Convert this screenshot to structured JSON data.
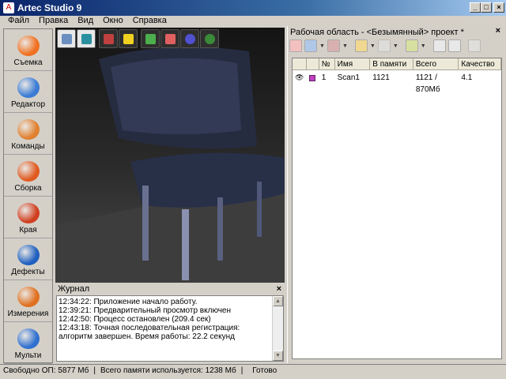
{
  "window": {
    "title": "Artec Studio 9",
    "minimize": "_",
    "maximize": "□",
    "close": "×"
  },
  "menu": [
    "Файл",
    "Правка",
    "Вид",
    "Окно",
    "Справка"
  ],
  "sidebar": [
    {
      "label": "Съемка",
      "color": "#f07020"
    },
    {
      "label": "Редактор",
      "color": "#3a7bd5"
    },
    {
      "label": "Команды",
      "color": "#e08030"
    },
    {
      "label": "Сборка",
      "color": "#e05a20"
    },
    {
      "label": "Края",
      "color": "#d04020"
    },
    {
      "label": "Дефекты",
      "color": "#2060c0"
    },
    {
      "label": "Измерения",
      "color": "#e07020"
    },
    {
      "label": "Мульти",
      "color": "#3070d0"
    }
  ],
  "viewport_tools": [
    {
      "name": "home-view",
      "color": "#6a8fc0",
      "active": true
    },
    {
      "name": "fit-view",
      "color": "#2a90a0",
      "active": true
    },
    {
      "name": "axes",
      "color": "#c04040"
    },
    {
      "name": "light",
      "color": "#f0d020"
    },
    {
      "name": "texture-cube",
      "color": "#4cae4c"
    },
    {
      "name": "solid-cube",
      "color": "#e06060"
    },
    {
      "name": "sphere",
      "color": "#5050d0"
    },
    {
      "name": "moon",
      "color": "#3a8a3a"
    }
  ],
  "journal": {
    "title": "Журнал",
    "close": "×",
    "lines": [
      "12:34:22: Приложение начало работу.",
      "12:39:21: Предварительный просмотр включен",
      "12:42:50: Процесс остановлен (209.4 сек)",
      "12:43:18: Точная последовательная регистрация: алгоритм завершен. Время работы: 22.2 секунд"
    ]
  },
  "workspace": {
    "title": "Рабочая область - <Безымянный> проект *",
    "close": "×",
    "columns": [
      "",
      "",
      "№",
      "Имя",
      "В памяти",
      "Всего",
      "Качество"
    ],
    "rows": [
      {
        "visible": "👁",
        "color": "#c040c0",
        "num": "1",
        "name": "Scan1",
        "in_memory": "1121",
        "total": "1121 / 870Мб",
        "quality": "4.1"
      }
    ]
  },
  "status": {
    "free": "Свободно ОП: 5877 Мб",
    "sep": "|",
    "used": "Всего памяти используется: 1238 Мб",
    "state": "Готово"
  }
}
